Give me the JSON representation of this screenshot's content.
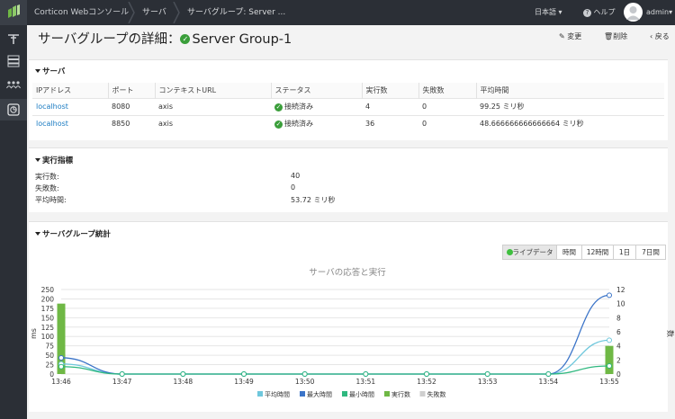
{
  "colors": {
    "bar": "#6fb845",
    "avg": "#6fc7dc",
    "max": "#3b74c8",
    "min": "#2fb87f",
    "errors": "#cfcfcf",
    "ok": "#3a9e3a",
    "link": "#1a7bc2"
  },
  "topbar": {
    "app_title": "Corticon Webコンソール",
    "breadcrumb_1": "サーバ",
    "breadcrumb_2": "サーバグループ: Server ...",
    "language": "日本語",
    "help": "ヘルプ",
    "user": "admin"
  },
  "sidebar": {
    "icons": [
      "rules-icon",
      "servers-icon",
      "users-icon",
      "monitor-icon"
    ]
  },
  "page": {
    "title_prefix": "サーバグループの詳細：",
    "title_name": "Server Group-1",
    "edit": "変更",
    "delete": "削除",
    "back": "戻る"
  },
  "servers": {
    "heading": "サーバ",
    "columns": [
      "IPアドレス",
      "ポート",
      "コンテキストURL",
      "ステータス",
      "実行数",
      "失敗数",
      "平均時間"
    ],
    "rows": [
      {
        "ip": "localhost",
        "port": "8080",
        "context": "axis",
        "status": "接続済み",
        "executions": "4",
        "failures": "0",
        "avg": "99.25 ミリ秒"
      },
      {
        "ip": "localhost",
        "port": "8850",
        "context": "axis",
        "status": "接続済み",
        "executions": "36",
        "failures": "0",
        "avg": "48.666666666666664 ミリ秒"
      }
    ]
  },
  "metrics": {
    "heading": "実行指標",
    "rows": [
      {
        "label": "実行数:",
        "value": "40"
      },
      {
        "label": "失敗数:",
        "value": "0"
      },
      {
        "label": "平均時間:",
        "value": "53.72 ミリ秒"
      }
    ]
  },
  "stats": {
    "heading": "サーバグループ統計",
    "ranges": [
      "ライブデータ",
      "時間",
      "12時間",
      "1日",
      "7日間"
    ],
    "active_range": "ライブデータ"
  },
  "chart_data": {
    "type": "line",
    "title": "サーバの応答と実行",
    "ylabel": "ms",
    "y2label": "数",
    "categories": [
      "13:46",
      "13:47",
      "13:48",
      "13:49",
      "13:50",
      "13:51",
      "13:52",
      "13:53",
      "13:54",
      "13:55"
    ],
    "ylim": [
      0,
      250
    ],
    "y2lim": [
      0,
      12
    ],
    "yticks": [
      "0",
      "25",
      "50",
      "75",
      "100",
      "125",
      "150",
      "175",
      "200",
      "250"
    ],
    "y2ticks": [
      "0",
      "2",
      "4",
      "6",
      "8",
      "10",
      "12"
    ],
    "series": [
      {
        "name": "平均時間",
        "axis": "left",
        "values": [
          30,
          0,
          0,
          0,
          0,
          0,
          0,
          0,
          0,
          100
        ]
      },
      {
        "name": "最大時間",
        "axis": "left",
        "values": [
          48,
          0,
          0,
          0,
          0,
          0,
          0,
          0,
          0,
          233
        ]
      },
      {
        "name": "最小時間",
        "axis": "left",
        "values": [
          22,
          0,
          0,
          0,
          0,
          0,
          0,
          0,
          0,
          24
        ]
      },
      {
        "name": "実行数",
        "axis": "right",
        "type": "bar",
        "values": [
          10,
          0,
          0,
          0,
          0,
          0,
          0,
          0,
          0,
          4
        ]
      },
      {
        "name": "失敗数",
        "axis": "right",
        "type": "bar",
        "values": [
          0,
          0,
          0,
          0,
          0,
          0,
          0,
          0,
          0,
          0
        ]
      }
    ]
  }
}
